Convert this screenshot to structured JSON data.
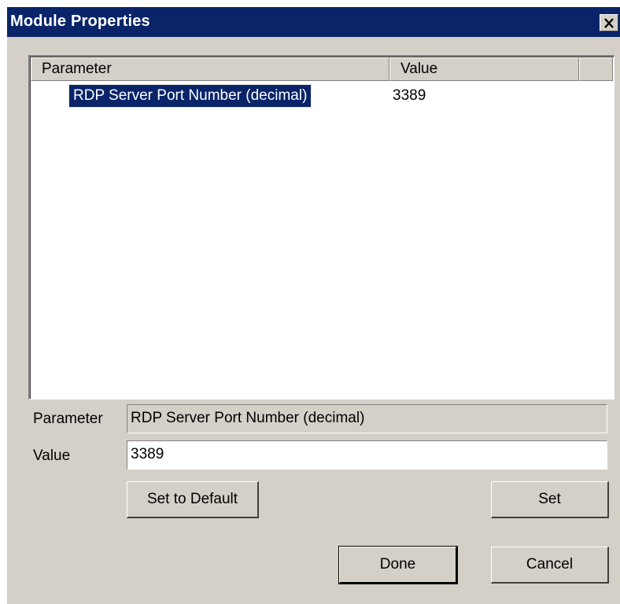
{
  "window": {
    "title": "Module Properties"
  },
  "list": {
    "columns": [
      "Parameter",
      "Value"
    ],
    "rows": [
      {
        "parameter": "RDP Server Port Number (decimal)",
        "value": "3389"
      }
    ]
  },
  "form": {
    "parameter_label": "Parameter",
    "parameter_value": "RDP Server Port Number (decimal)",
    "value_label": "Value",
    "value_value": "3389"
  },
  "buttons": {
    "set_default": "Set to Default",
    "set": "Set",
    "done": "Done",
    "cancel": "Cancel"
  },
  "icons": {
    "close": "close-icon"
  },
  "colors": {
    "titlebar": "#0a246a",
    "selection": "#0a246a",
    "face": "#d4d0c8"
  }
}
